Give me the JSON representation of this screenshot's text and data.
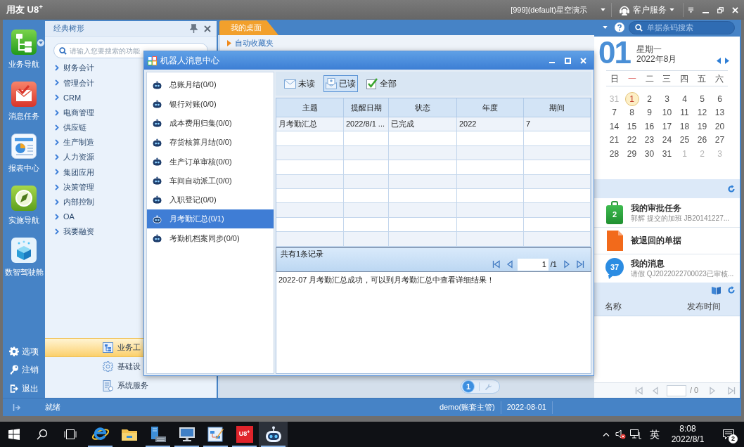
{
  "title_bar": {
    "logo": "用友 U8$^{+}$",
    "account": "[999](default)星空演示",
    "service": "客户服务"
  },
  "nav_rail": {
    "items": [
      {
        "kind": "business",
        "label": "业务导航",
        "dropdown": true
      },
      {
        "kind": "messages",
        "label": "消息任务",
        "dropdown": false
      },
      {
        "kind": "reports",
        "label": "报表中心",
        "dropdown": false
      },
      {
        "kind": "implementation",
        "label": "实施导航",
        "dropdown": false
      },
      {
        "kind": "cockpit",
        "label": "数智驾驶舱",
        "dropdown": false
      }
    ],
    "actions": [
      {
        "kind": "options",
        "label": "选项"
      },
      {
        "kind": "logout",
        "label": "注销"
      },
      {
        "kind": "exit",
        "label": "退出"
      }
    ]
  },
  "tree_panel": {
    "title": "经典树形",
    "search": {
      "placeholder": "请输入您要搜索的功能"
    },
    "items": [
      "财务会计",
      "管理会计",
      "CRM",
      "电商管理",
      "供应链",
      "生产制造",
      "人力资源",
      "集团应用",
      "决策管理",
      "内部控制",
      "OA",
      "我要融资"
    ],
    "menu": [
      {
        "kind": "business",
        "label": "业务工",
        "selected": true
      },
      {
        "kind": "settings",
        "label": "基础设",
        "selected": false
      },
      {
        "kind": "services",
        "label": "系统服务",
        "selected": false
      }
    ]
  },
  "desktop": {
    "tabs": [
      {
        "label": "我的桌面",
        "selected": true
      }
    ],
    "favorites": "自动收藏夹",
    "pages": [
      {
        "label": "1",
        "selected": true
      }
    ]
  },
  "dialog": {
    "title": "机器人消息中心",
    "robots": [
      {
        "label": "总账月结(0/0)",
        "selected": false
      },
      {
        "label": "银行对账(0/0)",
        "selected": false
      },
      {
        "label": "成本费用归集(0/0)",
        "selected": false
      },
      {
        "label": "存货核算月结(0/0)",
        "selected": false
      },
      {
        "label": "生产订单审核(0/0)",
        "selected": false
      },
      {
        "label": "车间自动派工(0/0)",
        "selected": false
      },
      {
        "label": "入职登记(0/0)",
        "selected": false
      },
      {
        "label": "月考勤汇总(0/1)",
        "selected": true
      },
      {
        "label": "考勤机档案同步(0/0)",
        "selected": false
      }
    ],
    "filters": [
      {
        "kind": "unread",
        "label": "未读",
        "selected": false
      },
      {
        "kind": "read",
        "label": "已读",
        "selected": true
      },
      {
        "kind": "all",
        "label": "全部",
        "selected": false
      }
    ],
    "table": {
      "columns": [
        "主题",
        "提醒日期",
        "状态",
        "年度",
        "期间"
      ],
      "rows": [
        [
          "月考勤汇总",
          "2022/8/1 ...",
          "已完成",
          "2022",
          "7"
        ]
      ]
    },
    "pager": {
      "summary": "共有1条记录",
      "page": "1",
      "total": "/1"
    },
    "message": "2022-07 月考勤汇总成功，可以到月考勤汇总中查看详细结果！"
  },
  "side_panel": {
    "search": {
      "placeholder": "单据条码搜索"
    },
    "calendar": {
      "day": "01",
      "weekday": "星期一",
      "month": "2022年8月",
      "weekdays": [
        {
          "label": "日",
          "selected": false
        },
        {
          "label": "一",
          "selected": true
        },
        {
          "label": "二",
          "selected": false
        },
        {
          "label": "三",
          "selected": false
        },
        {
          "label": "四",
          "selected": false
        },
        {
          "label": "五",
          "selected": false
        },
        {
          "label": "六",
          "selected": false
        }
      ],
      "days": [
        {
          "label": "31",
          "in_month": false,
          "selected": false
        },
        {
          "label": "1",
          "in_month": true,
          "selected": true
        },
        {
          "label": "2",
          "in_month": true,
          "selected": false
        },
        {
          "label": "3",
          "in_month": true,
          "selected": false
        },
        {
          "label": "4",
          "in_month": true,
          "selected": false
        },
        {
          "label": "5",
          "in_month": true,
          "selected": false
        },
        {
          "label": "6",
          "in_month": true,
          "selected": false
        },
        {
          "label": "7",
          "in_month": true,
          "selected": false
        },
        {
          "label": "8",
          "in_month": true,
          "selected": false
        },
        {
          "label": "9",
          "in_month": true,
          "selected": false
        },
        {
          "label": "10",
          "in_month": true,
          "selected": false
        },
        {
          "label": "11",
          "in_month": true,
          "selected": false
        },
        {
          "label": "12",
          "in_month": true,
          "selected": false
        },
        {
          "label": "13",
          "in_month": true,
          "selected": false
        },
        {
          "label": "14",
          "in_month": true,
          "selected": false
        },
        {
          "label": "15",
          "in_month": true,
          "selected": false
        },
        {
          "label": "16",
          "in_month": true,
          "selected": false
        },
        {
          "label": "17",
          "in_month": true,
          "selected": false
        },
        {
          "label": "18",
          "in_month": true,
          "selected": false
        },
        {
          "label": "19",
          "in_month": true,
          "selected": false
        },
        {
          "label": "20",
          "in_month": true,
          "selected": false
        },
        {
          "label": "21",
          "in_month": true,
          "selected": false
        },
        {
          "label": "22",
          "in_month": true,
          "selected": false
        },
        {
          "label": "23",
          "in_month": true,
          "selected": false
        },
        {
          "label": "24",
          "in_month": true,
          "selected": false
        },
        {
          "label": "25",
          "in_month": true,
          "selected": false
        },
        {
          "label": "26",
          "in_month": true,
          "selected": false
        },
        {
          "label": "27",
          "in_month": true,
          "selected": false
        },
        {
          "label": "28",
          "in_month": true,
          "selected": false
        },
        {
          "label": "29",
          "in_month": true,
          "selected": false
        },
        {
          "label": "30",
          "in_month": true,
          "selected": false
        },
        {
          "label": "31",
          "in_month": true,
          "selected": false
        },
        {
          "label": "1",
          "in_month": false,
          "selected": false
        },
        {
          "label": "2",
          "in_month": false,
          "selected": false
        },
        {
          "label": "3",
          "in_month": false,
          "selected": false
        }
      ]
    },
    "tasks": [
      {
        "kind": "approval",
        "title": "我的审批任务",
        "detail": "郭辉 提交的加班 JB20141227...",
        "badge": "2"
      },
      {
        "kind": "returned",
        "title": "被退回的单据"
      },
      {
        "kind": "message",
        "title": "我的消息",
        "detail": "请假 QJ2022022700023已审核...",
        "badge": "37"
      }
    ],
    "news": {
      "columns": [
        "名称",
        "发布时间"
      ],
      "pager": {
        "total": "/ 0"
      }
    }
  },
  "status_bar": {
    "status": "就绪",
    "user": "demo(账套主管)",
    "date": "2022-08-01"
  },
  "taskbar": {
    "apps": [
      {
        "kind": "browser",
        "running": true,
        "active": false
      },
      {
        "kind": "folder",
        "running": false,
        "active": false
      },
      {
        "kind": "server",
        "running": true,
        "active": false
      },
      {
        "kind": "monitor",
        "running": true,
        "active": false
      },
      {
        "kind": "editor",
        "running": true,
        "active": false
      },
      {
        "kind": "u8",
        "label": "U8$^{+}$",
        "running": true,
        "active": false
      },
      {
        "kind": "robot",
        "running": true,
        "active": true
      }
    ],
    "tray": {
      "ime": "英",
      "time": "8:08",
      "date": "2022/8/1",
      "notifications": "2"
    }
  }
}
